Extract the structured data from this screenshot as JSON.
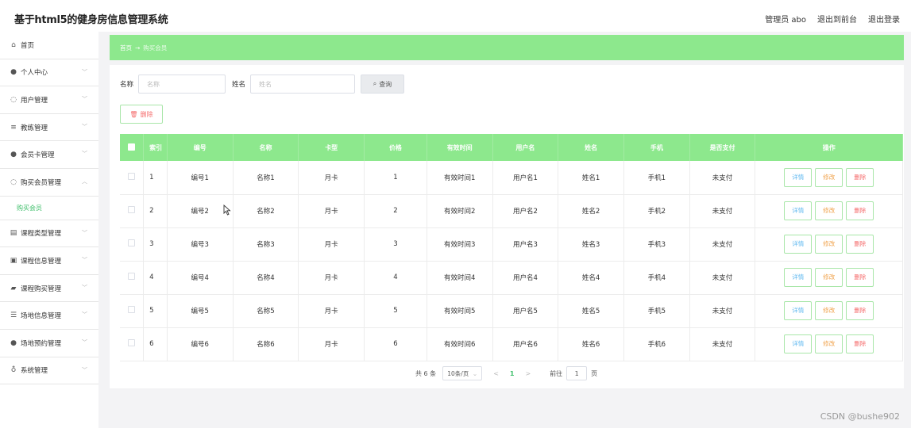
{
  "app_title": "基于html5的健身房信息管理系统",
  "topbar": {
    "admin": "管理员 abo",
    "back_front": "退出到前台",
    "logout": "退出登录"
  },
  "sidebar": {
    "items": [
      {
        "label": "首页",
        "icon": "home-icon",
        "glyph": "⌂"
      },
      {
        "label": "个人中心",
        "icon": "user-icon",
        "glyph": "●"
      },
      {
        "label": "用户管理",
        "icon": "users-icon",
        "glyph": "◌"
      },
      {
        "label": "教练管理",
        "icon": "sliders-icon",
        "glyph": "≡"
      },
      {
        "label": "会员卡管理",
        "icon": "card-user-icon",
        "glyph": "●"
      },
      {
        "label": "购买会员管理",
        "icon": "member-icon",
        "glyph": "◌"
      },
      {
        "label": "课程类型管理",
        "icon": "tag-icon",
        "glyph": "▤"
      },
      {
        "label": "课程信息管理",
        "icon": "doc-icon",
        "glyph": "▣"
      },
      {
        "label": "课程购买管理",
        "icon": "cart-icon",
        "glyph": "▰"
      },
      {
        "label": "场地信息管理",
        "icon": "list-icon",
        "glyph": "☰"
      },
      {
        "label": "场地预约管理",
        "icon": "person-icon",
        "glyph": "●"
      },
      {
        "label": "系统管理",
        "icon": "mic-icon",
        "glyph": "♁"
      }
    ],
    "sub_item": "购买会员"
  },
  "breadcrumb": {
    "home": "首页",
    "arrow": "→",
    "current": "购买会员"
  },
  "search": {
    "name_label": "名称",
    "name_placeholder": "名称",
    "realname_label": "姓名",
    "realname_placeholder": "姓名",
    "button": "查询"
  },
  "delete_button": "删除",
  "table": {
    "headers": [
      "索引",
      "编号",
      "名称",
      "卡型",
      "价格",
      "有效时间",
      "用户名",
      "姓名",
      "手机",
      "是否支付",
      "操作"
    ],
    "rows": [
      [
        "1",
        "编号1",
        "名称1",
        "月卡",
        "1",
        "有效时间1",
        "用户名1",
        "姓名1",
        "手机1",
        "未支付"
      ],
      [
        "2",
        "编号2",
        "名称2",
        "月卡",
        "2",
        "有效时间2",
        "用户名2",
        "姓名2",
        "手机2",
        "未支付"
      ],
      [
        "3",
        "编号3",
        "名称3",
        "月卡",
        "3",
        "有效时间3",
        "用户名3",
        "姓名3",
        "手机3",
        "未支付"
      ],
      [
        "4",
        "编号4",
        "名称4",
        "月卡",
        "4",
        "有效时间4",
        "用户名4",
        "姓名4",
        "手机4",
        "未支付"
      ],
      [
        "5",
        "编号5",
        "名称5",
        "月卡",
        "5",
        "有效时间5",
        "用户名5",
        "姓名5",
        "手机5",
        "未支付"
      ],
      [
        "6",
        "编号6",
        "名称6",
        "月卡",
        "6",
        "有效时间6",
        "用户名6",
        "姓名6",
        "手机6",
        "未支付"
      ]
    ],
    "actions": {
      "detail": "详情",
      "edit": "修改",
      "delete": "删除"
    }
  },
  "pager": {
    "total": "共 6 条",
    "page_size": "10条/页",
    "prev": "<",
    "current_page": "1",
    "next": ">",
    "goto_label": "前往",
    "goto_value": "1",
    "page_unit": "页"
  },
  "watermark": "CSDN @bushe902",
  "colors": {
    "accent": "#8de88d",
    "active_text": "#3fbf6b",
    "danger": "#f56c6c",
    "warning": "#f0a24b",
    "info": "#5fb8f0"
  }
}
